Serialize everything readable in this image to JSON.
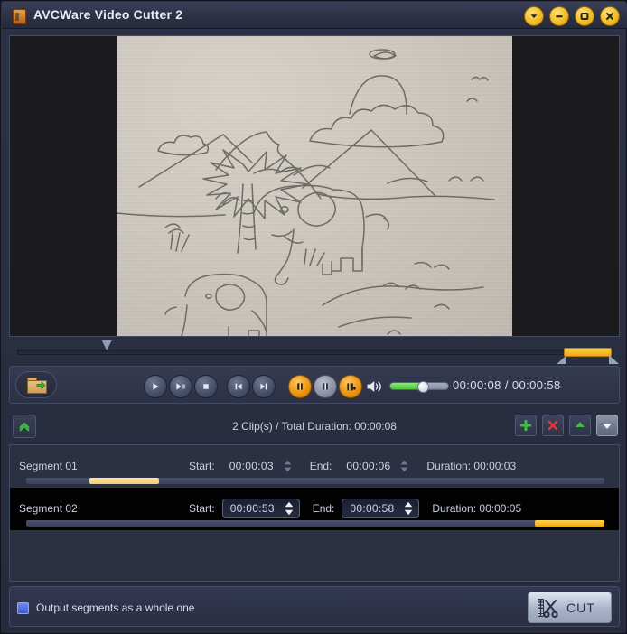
{
  "window": {
    "title": "AVCWare Video Cutter 2",
    "app_icon": "app-icon",
    "controls": [
      {
        "name": "chevron-down-button",
        "icon": "chevron-down-icon"
      },
      {
        "name": "minimize-button",
        "icon": "minimize-icon"
      },
      {
        "name": "maximize-button",
        "icon": "maximize-icon"
      },
      {
        "name": "close-button",
        "icon": "close-icon"
      }
    ],
    "accent_color": "#f0b81f"
  },
  "preview": {
    "name": "video-preview",
    "content_description": "pencil sketch of two elephants, palm tree, mountains and clouds on paper"
  },
  "timeline": {
    "playhead_percent": 15,
    "selection_start_percent": 92,
    "selection_end_percent": 101
  },
  "transport": {
    "open_file_label": "open-file",
    "buttons": [
      {
        "name": "play-button",
        "icon": "play-icon"
      },
      {
        "name": "frame-step-button",
        "icon": "frame-step-icon"
      },
      {
        "name": "stop-button",
        "icon": "stop-icon"
      },
      {
        "name": "previous-button",
        "icon": "previous-icon"
      },
      {
        "name": "next-button",
        "icon": "next-icon"
      },
      {
        "name": "set-start-button",
        "icon": "mark-in-icon"
      },
      {
        "name": "set-end-button",
        "icon": "mark-out-icon"
      },
      {
        "name": "add-segment-button",
        "icon": "add-clip-icon"
      }
    ],
    "volume_percent": 55,
    "time_display": "00:00:08 / 00:00:58",
    "current_time": "00:00:08",
    "total_time": "00:00:58"
  },
  "cliplist": {
    "summary": "2 Clip(s) /  Total Duration: 00:00:08",
    "clip_count": 2,
    "total_duration": "00:00:08",
    "collapse_label": "collapse-panel",
    "actions": [
      {
        "name": "add-segment-button",
        "icon": "plus-icon",
        "color": "#3fbf3f"
      },
      {
        "name": "delete-segment-button",
        "icon": "cross-icon",
        "color": "#d83a3a"
      },
      {
        "name": "move-up-button",
        "icon": "arrow-up-icon",
        "color": "#3fbf3f"
      },
      {
        "name": "move-down-button",
        "icon": "arrow-down-icon",
        "color": "#e8edf6"
      }
    ]
  },
  "segments": {
    "start_label": "Start:",
    "end_label": "End:",
    "duration_label": "Duration:",
    "rows": [
      {
        "name": "Segment 01",
        "start": "00:00:03",
        "end": "00:00:06",
        "duration": "Duration: 00:00:03",
        "selected": false,
        "range_start_percent": 11,
        "range_width_percent": 12
      },
      {
        "name": "Segment 02",
        "start": "00:00:53",
        "end": "00:00:58",
        "duration": "Duration: 00:00:05",
        "selected": true,
        "range_start_percent": 88,
        "range_width_percent": 12
      }
    ]
  },
  "footer": {
    "checkbox_label": "Output segments as a whole one",
    "checkbox_checked": true,
    "cut_label": "CUT"
  }
}
